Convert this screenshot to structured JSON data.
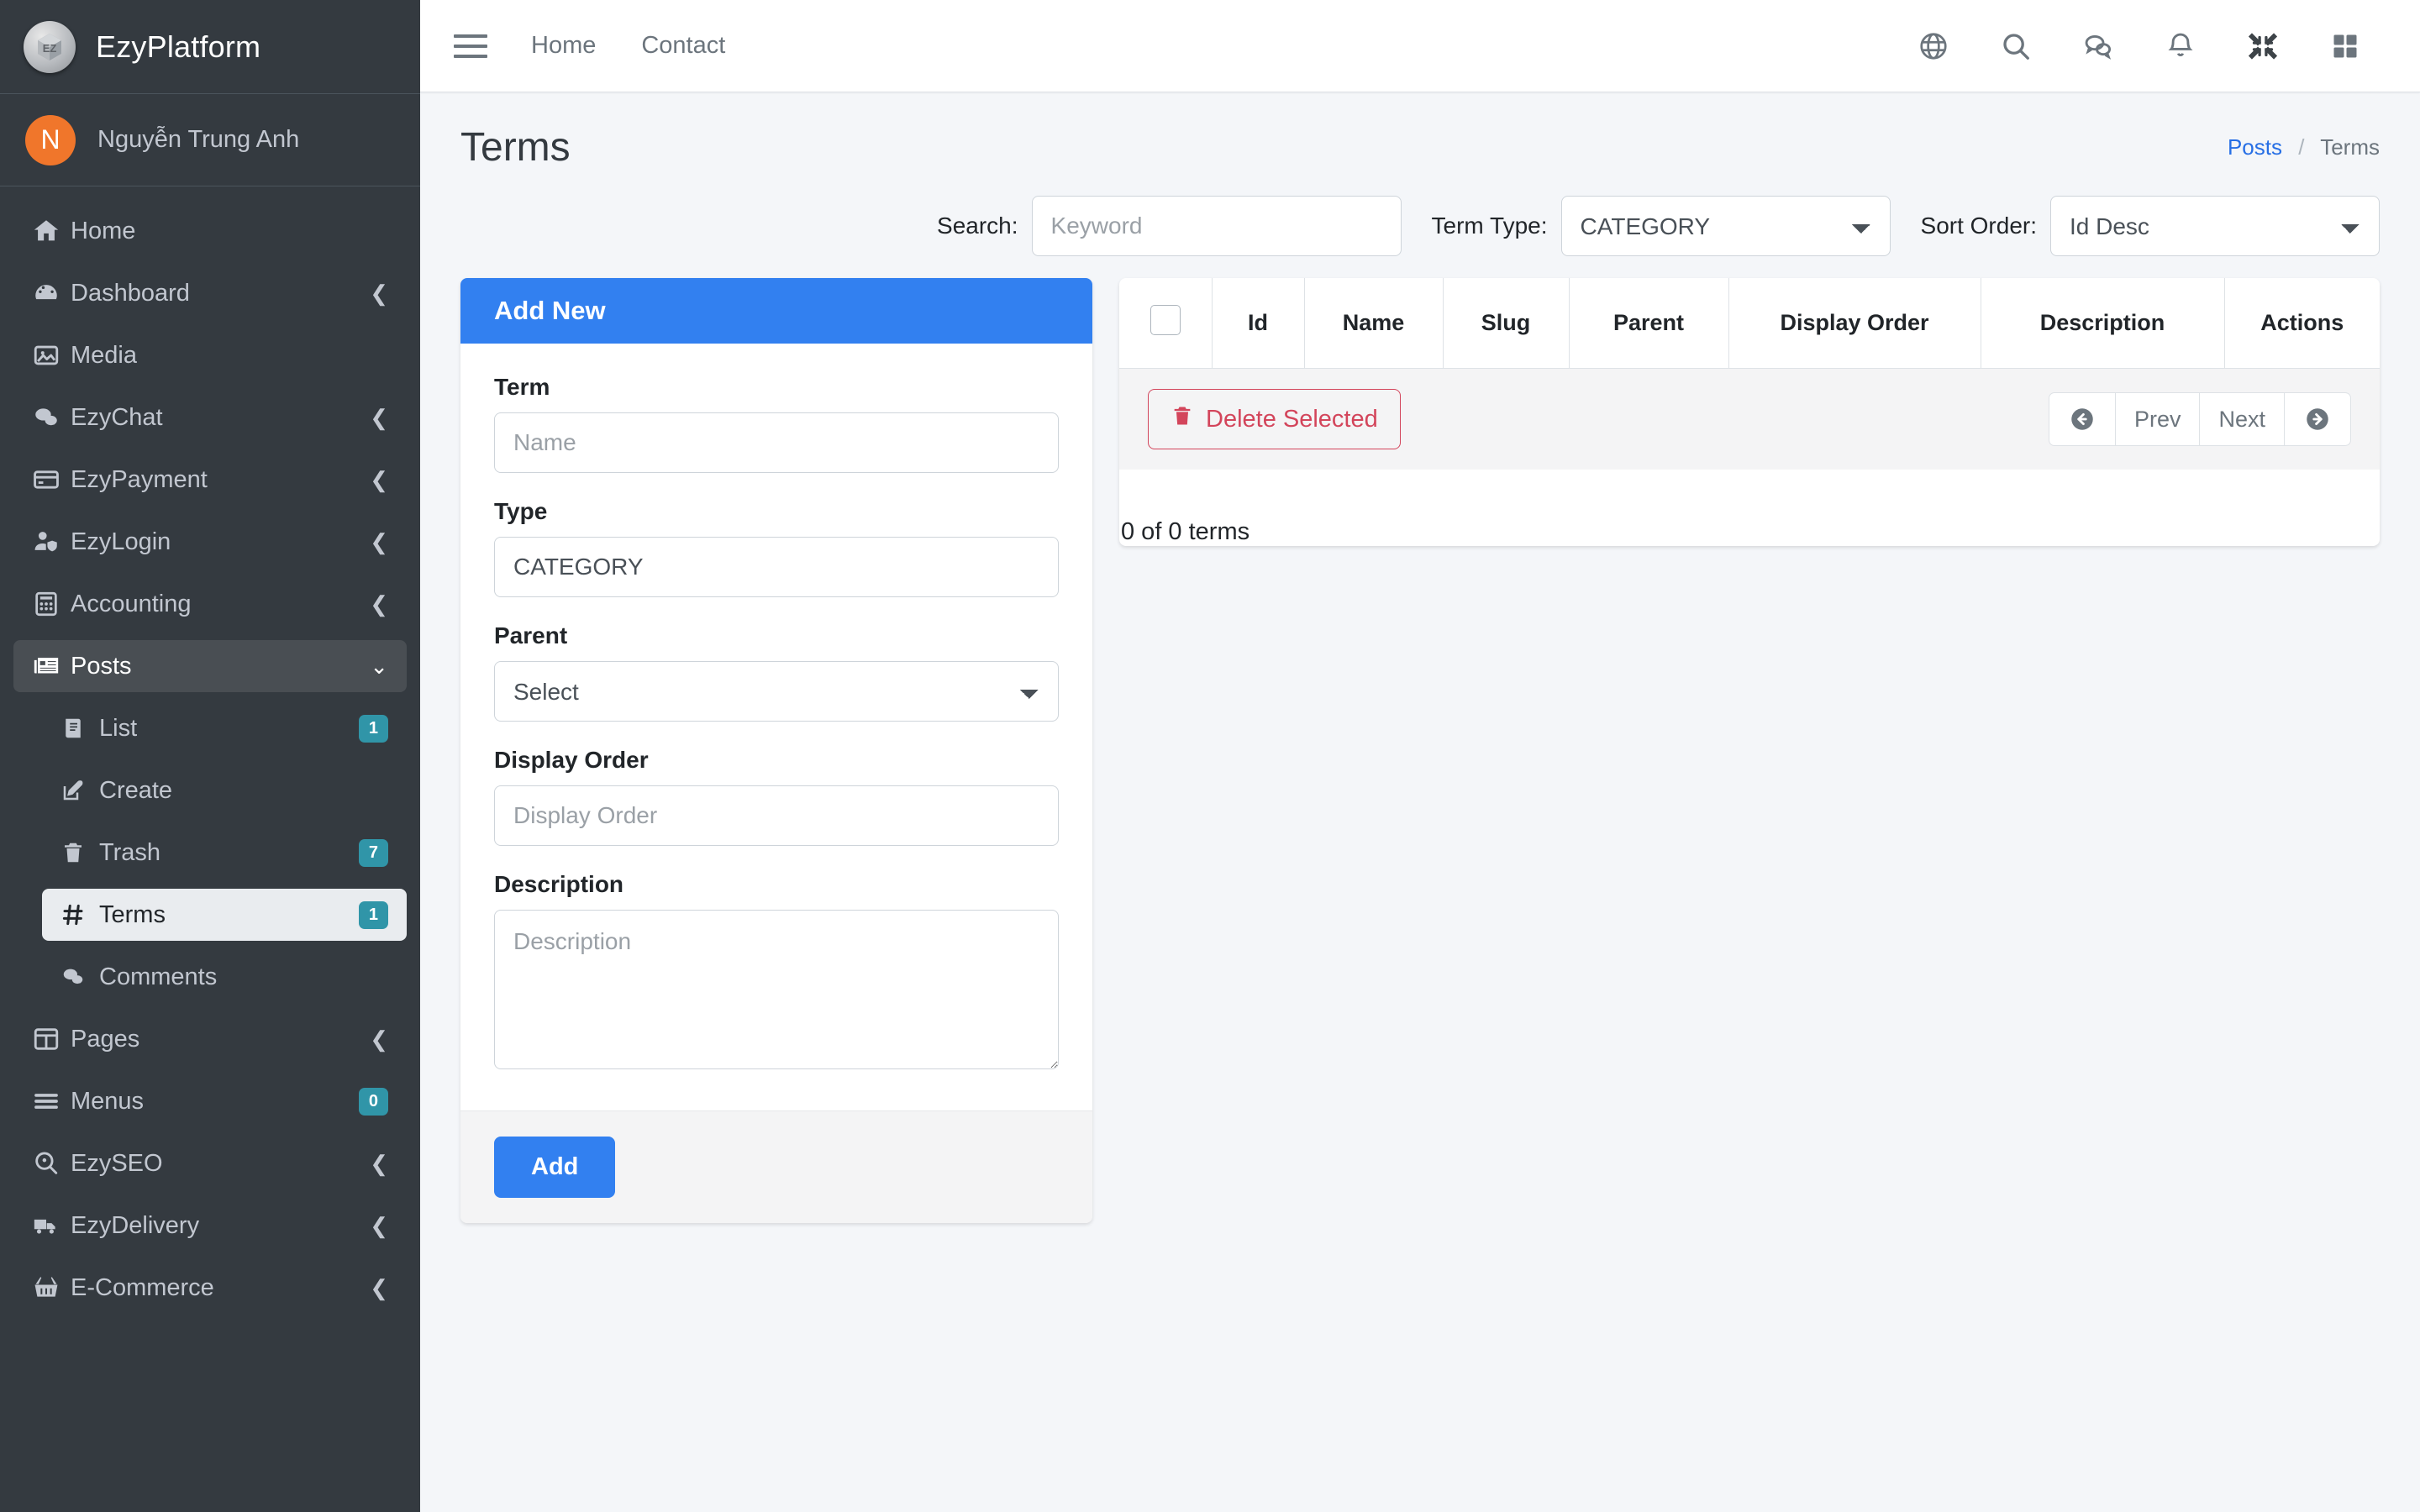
{
  "brand": {
    "title": "EzyPlatform",
    "logo_icon": "ezy-cube-logo-icon"
  },
  "user": {
    "initial": "N",
    "name": "Nguyễn Trung Anh"
  },
  "sidebar": {
    "items": [
      {
        "label": "Home",
        "icon": "home-icon",
        "arrow": "",
        "badge": ""
      },
      {
        "label": "Dashboard",
        "icon": "dashboard-gauge-icon",
        "arrow": "left",
        "badge": ""
      },
      {
        "label": "Media",
        "icon": "image-icon",
        "arrow": "",
        "badge": ""
      },
      {
        "label": "EzyChat",
        "icon": "chat-bubbles-icon",
        "arrow": "left",
        "badge": ""
      },
      {
        "label": "EzyPayment",
        "icon": "credit-card-icon",
        "arrow": "left",
        "badge": ""
      },
      {
        "label": "EzyLogin",
        "icon": "user-shield-icon",
        "arrow": "left",
        "badge": ""
      },
      {
        "label": "Accounting",
        "icon": "calculator-icon",
        "arrow": "left",
        "badge": ""
      },
      {
        "label": "Posts",
        "icon": "newspaper-icon",
        "arrow": "down",
        "badge": "",
        "state": "active-parent"
      }
    ],
    "posts_sub": [
      {
        "label": "List",
        "icon": "book-icon",
        "badge": "1"
      },
      {
        "label": "Create",
        "icon": "edit-pencil-icon",
        "badge": ""
      },
      {
        "label": "Trash",
        "icon": "trash-icon",
        "badge": "7"
      },
      {
        "label": "Terms",
        "icon": "hash-icon",
        "badge": "1",
        "state": "active-child"
      },
      {
        "label": "Comments",
        "icon": "comments-icon",
        "badge": ""
      }
    ],
    "items_after": [
      {
        "label": "Pages",
        "icon": "columns-icon",
        "arrow": "left",
        "badge": ""
      },
      {
        "label": "Menus",
        "icon": "bars-icon",
        "arrow": "",
        "badge": "0"
      },
      {
        "label": "EzySEO",
        "icon": "search-location-icon",
        "arrow": "left",
        "badge": ""
      },
      {
        "label": "EzyDelivery",
        "icon": "truck-icon",
        "arrow": "left",
        "badge": ""
      },
      {
        "label": "E-Commerce",
        "icon": "basket-icon",
        "arrow": "left",
        "badge": ""
      }
    ]
  },
  "topbar": {
    "menu_toggle_icon": "hamburger-icon",
    "links": [
      "Home",
      "Contact"
    ],
    "icons": [
      "globe-icon",
      "search-icon",
      "chat-icon",
      "bell-icon",
      "compress-icon",
      "grid-icon"
    ]
  },
  "page": {
    "title": "Terms",
    "breadcrumb_parent": "Posts",
    "breadcrumb_sep": "/",
    "breadcrumb_current": "Terms"
  },
  "filters": {
    "search_label": "Search:",
    "search_placeholder": "Keyword",
    "search_value": "",
    "term_type_label": "Term Type:",
    "term_type_value": "CATEGORY",
    "sort_order_label": "Sort Order:",
    "sort_order_value": "Id Desc"
  },
  "form": {
    "header": "Add New",
    "term_label": "Term",
    "term_placeholder": "Name",
    "term_value": "",
    "type_label": "Type",
    "type_value": "CATEGORY",
    "parent_label": "Parent",
    "parent_value": "Select",
    "display_order_label": "Display Order",
    "display_order_placeholder": "Display Order",
    "display_order_value": "",
    "description_label": "Description",
    "description_placeholder": "Description",
    "description_value": "",
    "add_button": "Add"
  },
  "table": {
    "columns": [
      "",
      "Id",
      "Name",
      "Slug",
      "Parent",
      "Display Order",
      "Description",
      "Actions"
    ],
    "rows": [],
    "delete_button": "Delete Selected",
    "pager": {
      "first_icon": "arrow-circle-left-icon",
      "prev": "Prev",
      "next": "Next",
      "last_icon": "arrow-circle-right-icon"
    }
  },
  "footer": {
    "count_text": "0 of 0 terms"
  },
  "colors": {
    "sidebar_bg": "#343a40",
    "primary": "#3280f0",
    "danger": "#d3455b",
    "badge": "#3095a8",
    "avatar": "#f0762b",
    "link": "#276fe5"
  }
}
